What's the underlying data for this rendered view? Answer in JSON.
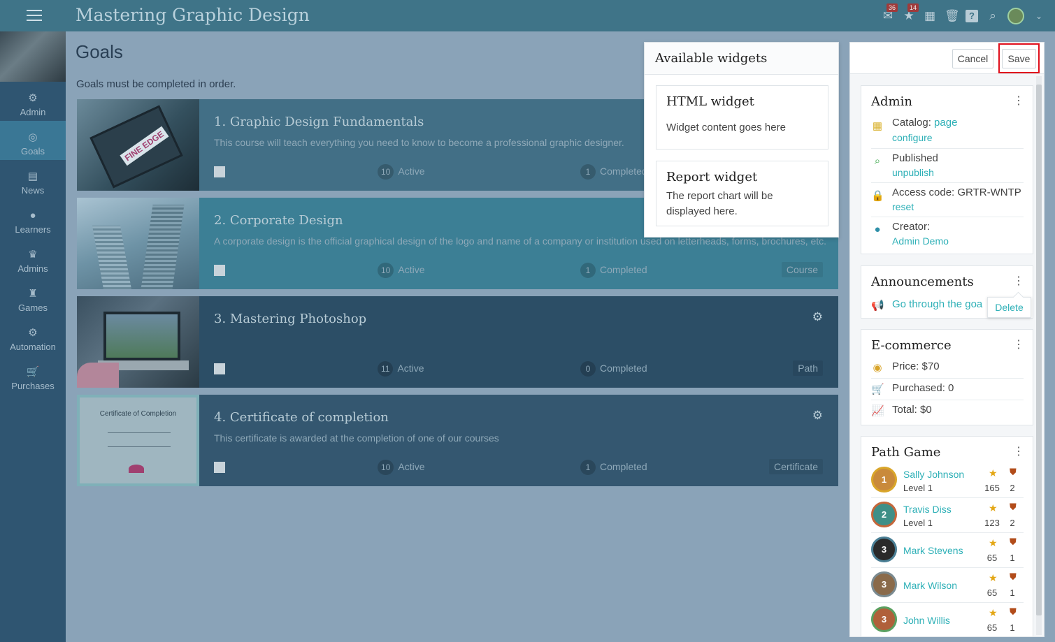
{
  "app": {
    "title": "Mastering Graphic Design",
    "accent": "#3f7488"
  },
  "topbar": {
    "icons": [
      {
        "name": "messages-icon",
        "badge": "36"
      },
      {
        "name": "star-icon",
        "badge": "14"
      },
      {
        "name": "calendar-icon",
        "badge": ""
      },
      {
        "name": "trash-icon",
        "badge": ""
      },
      {
        "name": "help-icon",
        "badge": ""
      },
      {
        "name": "search-icon",
        "badge": ""
      }
    ]
  },
  "sidebar": {
    "items": [
      {
        "label": "Admin",
        "icon": "gear-icon"
      },
      {
        "label": "Goals",
        "icon": "target-icon"
      },
      {
        "label": "News",
        "icon": "newspaper-icon"
      },
      {
        "label": "Learners",
        "icon": "user-icon"
      },
      {
        "label": "Admins",
        "icon": "crown-icon"
      },
      {
        "label": "Games",
        "icon": "trophy-icon"
      },
      {
        "label": "Automation",
        "icon": "gears-icon"
      },
      {
        "label": "Purchases",
        "icon": "cart-icon"
      }
    ]
  },
  "main": {
    "title": "Goals",
    "subtitle": "Goals must be completed in order.",
    "goals": [
      {
        "title": "1. Graphic Design Fundamentals",
        "description": "This course will teach everything you need to know to become a professional graphic designer.",
        "active_count": "10",
        "active_label": "Active",
        "completed_count": "1",
        "completed_label": "Completed",
        "type": ""
      },
      {
        "title": "2. Corporate Design",
        "description": "A corporate design is the official graphical design of the logo and name of a company or institution used on letterheads, forms, brochures, etc.",
        "active_count": "10",
        "active_label": "Active",
        "completed_count": "1",
        "completed_label": "Completed",
        "type": "Course"
      },
      {
        "title": "3. Mastering Photoshop",
        "description": "",
        "active_count": "11",
        "active_label": "Active",
        "completed_count": "0",
        "completed_label": "Completed",
        "type": "Path"
      },
      {
        "title": "4. Certificate of completion",
        "description": "This certificate is awarded at the completion of one of our courses",
        "active_count": "10",
        "active_label": "Active",
        "completed_count": "1",
        "completed_label": "Completed",
        "type": "Certificate"
      }
    ],
    "thumb_texts": {
      "logo": "FINE EDGE",
      "certificate": "Certificate of Completion"
    }
  },
  "widgets": {
    "title": "Available widgets",
    "items": [
      {
        "title": "HTML widget",
        "description": "Widget content goes here"
      },
      {
        "title": "Report widget",
        "description": "The report chart will be displayed here."
      }
    ]
  },
  "panel": {
    "cancel_label": "Cancel",
    "save_label": "Save",
    "admin": {
      "title": "Admin",
      "catalog_label": "Catalog:",
      "catalog_value": "page",
      "catalog_action": "configure",
      "published_label": "Published",
      "published_action": "unpublish",
      "access_label": "Access code: GRTR-WNTP",
      "access_action": "reset",
      "creator_label": "Creator:",
      "creator_value": "Admin Demo"
    },
    "announcements": {
      "title": "Announcements",
      "item": "Go through the goa",
      "delete_label": "Delete"
    },
    "ecommerce": {
      "title": "E-commerce",
      "price": "Price: $70",
      "purchased": "Purchased: 0",
      "total": "Total: $0"
    },
    "path_game": {
      "title": "Path Game",
      "players": [
        {
          "rank": "1",
          "name": "Sally Johnson",
          "level": "Level 1",
          "score": "165",
          "badges": "2"
        },
        {
          "rank": "2",
          "name": "Travis Diss",
          "level": "Level 1",
          "score": "123",
          "badges": "2"
        },
        {
          "rank": "3",
          "name": "Mark Stevens",
          "level": "",
          "score": "65",
          "badges": "1"
        },
        {
          "rank": "3",
          "name": "Mark Wilson",
          "level": "",
          "score": "65",
          "badges": "1"
        },
        {
          "rank": "3",
          "name": "John Willis",
          "level": "",
          "score": "65",
          "badges": "1"
        }
      ]
    }
  }
}
